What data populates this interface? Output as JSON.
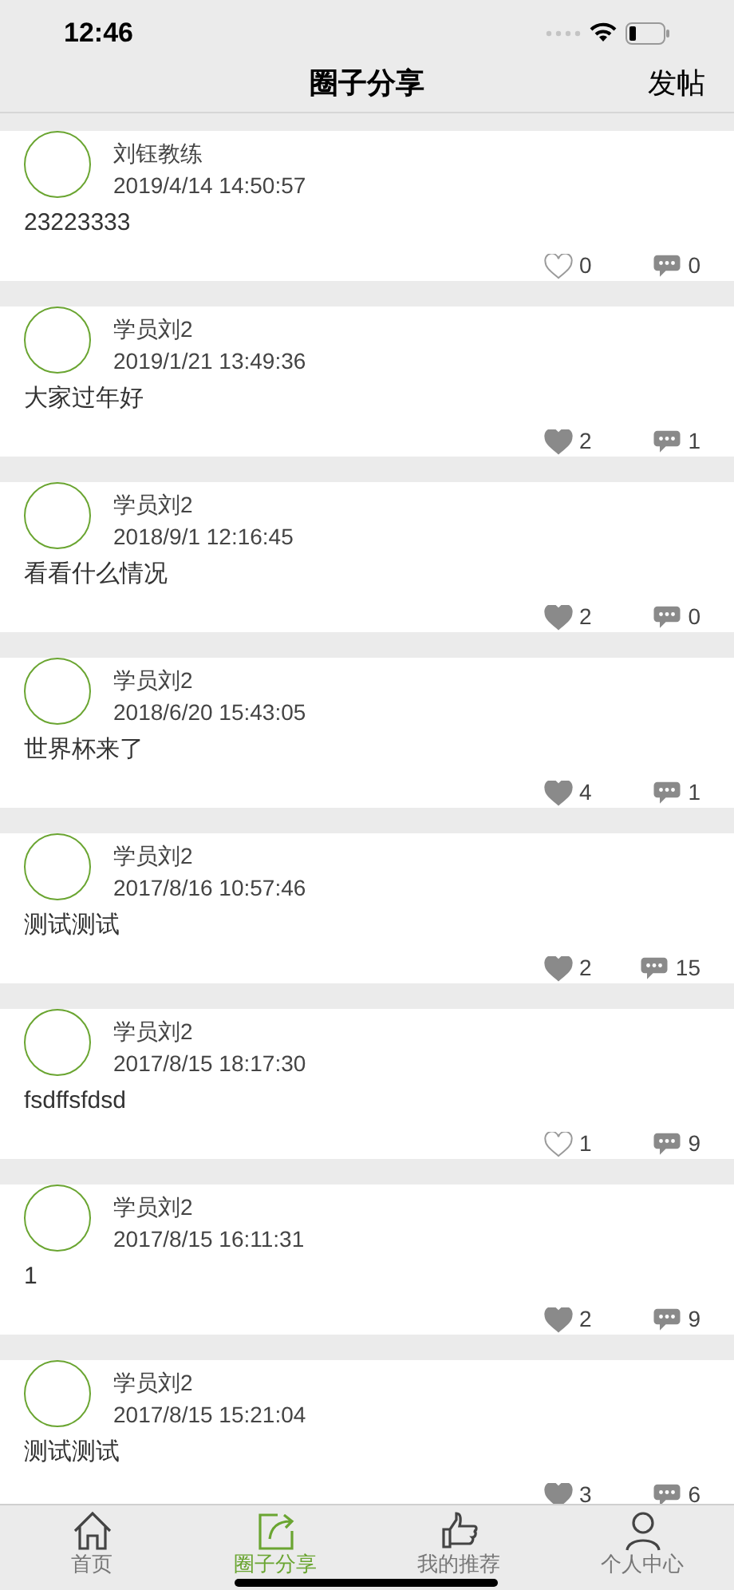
{
  "status_bar": {
    "time": "12:46"
  },
  "nav": {
    "title": "圈子分享",
    "action": "发帖"
  },
  "posts": [
    {
      "author": "刘钰教练",
      "time": "2019/4/14 14:50:57",
      "content": "23223333",
      "liked": false,
      "likes": "0",
      "comments": "0"
    },
    {
      "author": "学员刘2",
      "time": "2019/1/21 13:49:36",
      "content": "大家过年好",
      "liked": true,
      "likes": "2",
      "comments": "1"
    },
    {
      "author": "学员刘2",
      "time": "2018/9/1 12:16:45",
      "content": "看看什么情况",
      "liked": true,
      "likes": "2",
      "comments": "0"
    },
    {
      "author": "学员刘2",
      "time": "2018/6/20 15:43:05",
      "content": "世界杯来了",
      "liked": true,
      "likes": "4",
      "comments": "1"
    },
    {
      "author": "学员刘2",
      "time": "2017/8/16 10:57:46",
      "content": "测试测试",
      "liked": true,
      "likes": "2",
      "comments": "15"
    },
    {
      "author": "学员刘2",
      "time": "2017/8/15 18:17:30",
      "content": "fsdffsfdsd",
      "liked": false,
      "likes": "1",
      "comments": "9"
    },
    {
      "author": "学员刘2",
      "time": "2017/8/15 16:11:31",
      "content": "1",
      "liked": true,
      "likes": "2",
      "comments": "9"
    },
    {
      "author": "学员刘2",
      "time": "2017/8/15 15:21:04",
      "content": "测试测试",
      "liked": true,
      "likes": "3",
      "comments": "6"
    }
  ],
  "tabs": [
    {
      "kind": "home",
      "label": "首页",
      "selected": false
    },
    {
      "kind": "share",
      "label": "圈子分享",
      "selected": true
    },
    {
      "kind": "thumb",
      "label": "我的推荐",
      "selected": false
    },
    {
      "kind": "person",
      "label": "个人中心",
      "selected": false
    }
  ]
}
